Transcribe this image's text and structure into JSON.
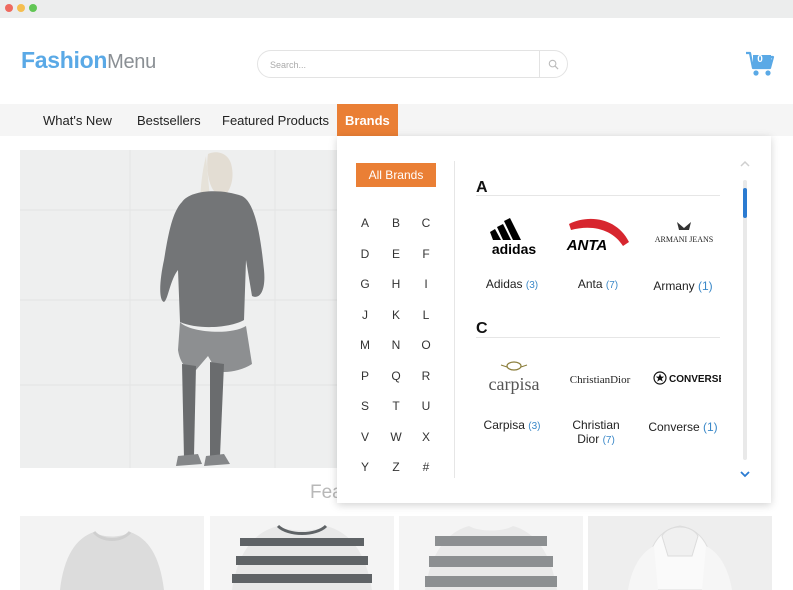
{
  "window": {
    "traffic_lights": [
      "close",
      "minimize",
      "maximize"
    ]
  },
  "header": {
    "logo_bold": "Fashion",
    "logo_light": "Menu",
    "search_placeholder": "Search...",
    "cart_count": "0"
  },
  "nav": {
    "items": [
      {
        "label": "What's New"
      },
      {
        "label": "Bestsellers"
      },
      {
        "label": "Featured Products"
      },
      {
        "label": "Brands",
        "active": true
      }
    ]
  },
  "featured_title": "Fea",
  "mega_menu": {
    "all_brands_label": "All Brands",
    "letters": [
      "A",
      "B",
      "C",
      "D",
      "E",
      "F",
      "G",
      "H",
      "I",
      "J",
      "K",
      "L",
      "M",
      "N",
      "O",
      "P",
      "Q",
      "R",
      "S",
      "T",
      "U",
      "V",
      "W",
      "X",
      "Y",
      "Z",
      "#"
    ],
    "groups": [
      {
        "letter": "A",
        "brands": [
          {
            "name": "Adidas",
            "count": "(3)",
            "logo": "adidas-logo"
          },
          {
            "name": "Anta",
            "count": "(7)",
            "logo": "anta-logo"
          },
          {
            "name": "Armany",
            "count": "(1)",
            "logo": "armani-jeans-logo",
            "logo_text": "ARMANI JEANS"
          }
        ]
      },
      {
        "letter": "C",
        "brands": [
          {
            "name": "Carpisa",
            "count": "(3)",
            "logo": "carpisa-logo",
            "logo_text": "carpisa"
          },
          {
            "name_line1": "Christian",
            "name_line2": "Dior",
            "count": "(7)",
            "logo": "christian-dior-logo",
            "logo_text": "ChristianDior"
          },
          {
            "name": "Converse",
            "count": "(1)",
            "logo": "converse-logo",
            "logo_text": "CONVERSE"
          }
        ]
      }
    ]
  },
  "colors": {
    "accent": "#ea7f35",
    "brand_blue": "#5aa9e6",
    "count_blue": "#3a88c8",
    "scroll_thumb": "#2b7bd1"
  }
}
